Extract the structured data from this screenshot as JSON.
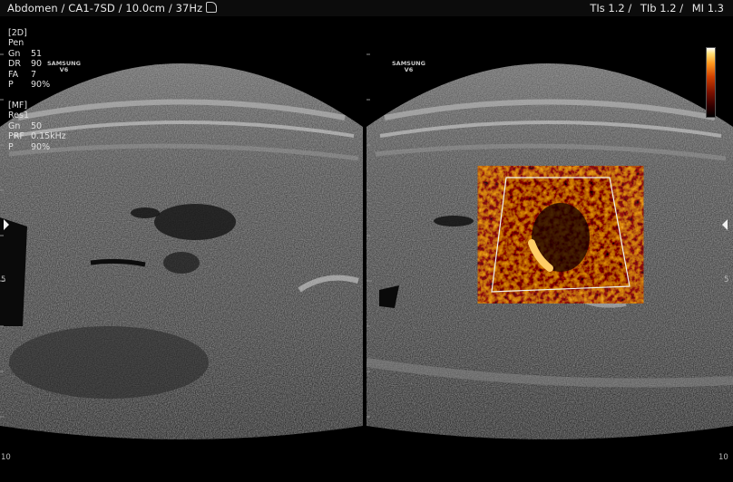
{
  "header": {
    "exam": "Abdomen",
    "probe": "CA1-7SD",
    "depth": "10.0cm",
    "frame_rate": "37Hz",
    "tis": "TIs  1.2",
    "tib": "TIb  1.2",
    "mi": "MI    1.3"
  },
  "params_2d": [
    {
      "k": "[2D]",
      "v": ""
    },
    {
      "k": "Pen",
      "v": ""
    },
    {
      "k": "Gn",
      "v": "51"
    },
    {
      "k": "DR",
      "v": "90"
    },
    {
      "k": "FA",
      "v": "7"
    },
    {
      "k": "P",
      "v": "90%"
    }
  ],
  "params_mf": [
    {
      "k": "[MF]",
      "v": ""
    },
    {
      "k": "Res1",
      "v": ""
    },
    {
      "k": "Gn",
      "v": "50"
    },
    {
      "k": "PRF",
      "v": "0.15kHz"
    },
    {
      "k": "P",
      "v": "90%"
    }
  ],
  "brand": {
    "line1": "SAMSUNG",
    "line2": "V6"
  },
  "depth_scale": {
    "mid": "5",
    "bottom": "10"
  },
  "colors": {
    "accent": "#ffffff",
    "flow_hot": "#ff9a20",
    "flow_dark": "#5a0a00"
  },
  "icons": {
    "probe": "probe-icon",
    "focus_left": "focus-marker-left",
    "focus_right": "focus-marker-right"
  }
}
